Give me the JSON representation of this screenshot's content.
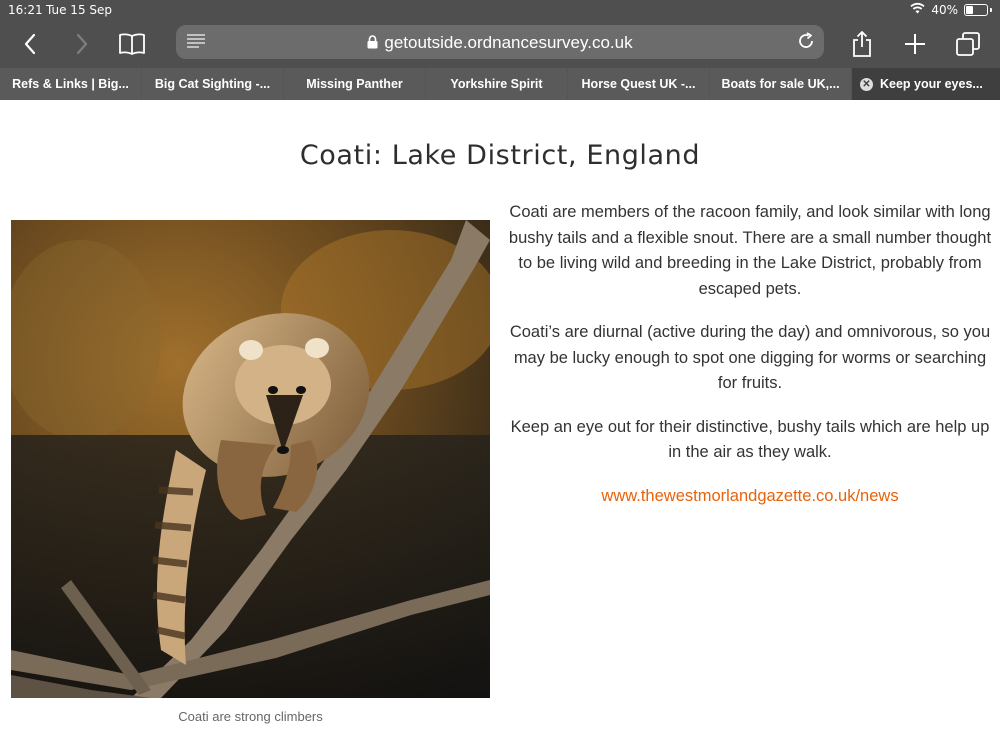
{
  "status": {
    "time": "16:21",
    "date": "Tue 15 Sep",
    "battery_percent": 40,
    "battery_label": "40%"
  },
  "toolbar": {
    "url": "getoutside.ordnancesurvey.co.uk",
    "icons": [
      "back-icon",
      "forward-icon",
      "bookmarks-icon",
      "reader-icon",
      "lock-icon",
      "reload-icon",
      "share-icon",
      "new-tab-icon",
      "tabs-icon"
    ]
  },
  "tabs": [
    {
      "label": "Refs & Links | Big..."
    },
    {
      "label": "Big Cat Sighting -..."
    },
    {
      "label": "Missing Panther"
    },
    {
      "label": "Yorkshire Spirit"
    },
    {
      "label": "Horse Quest UK -..."
    },
    {
      "label": "Boats for sale UK,..."
    },
    {
      "label": "Keep your eyes...",
      "active": true
    }
  ],
  "article": {
    "title": "Coati: Lake District, England",
    "caption": "Coati are strong climbers",
    "paragraphs": [
      "Coati are members of the racoon family, and look similar with long bushy tails and a flexible snout. There are a small number thought to be living wild and breeding in the Lake District, probably from escaped pets.",
      "Coati’s are diurnal (active during the day) and omnivorous, so you may be lucky enough to spot one digging for worms or searching for fruits.",
      "Keep an eye out for their distinctive, bushy tails which are help up in the air as they walk."
    ],
    "link": "www.thewestmorlandgazette.co.uk/news"
  },
  "colors": {
    "chrome": "#4f4f4f",
    "tab_bar": "#3f3f3f",
    "link": "#e8620a"
  }
}
